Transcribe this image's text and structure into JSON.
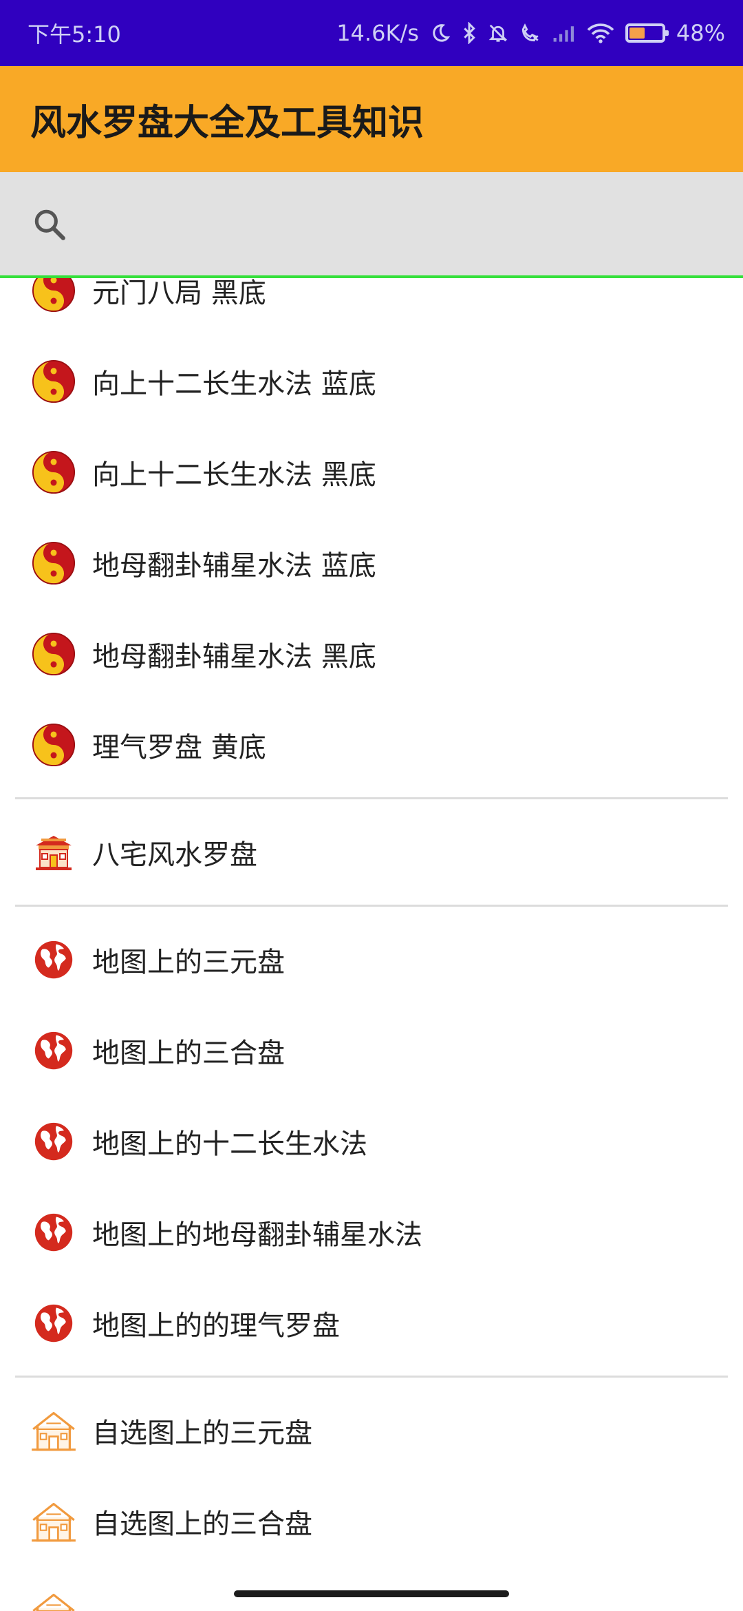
{
  "status_bar": {
    "time": "下午5:10",
    "network_speed": "14.6K/s",
    "battery_percent": "48%",
    "battery_level": 0.48,
    "icons": [
      "moon-icon",
      "bluetooth-icon",
      "mute-bell-icon",
      "call-icon",
      "signal-icon",
      "wifi-icon",
      "battery-icon"
    ]
  },
  "app_bar": {
    "title": "风水罗盘大全及工具知识"
  },
  "search": {
    "placeholder": "",
    "value": "",
    "icon": "search-icon"
  },
  "list": {
    "group_compass": [
      {
        "label": "元门八局 黑底",
        "icon": "yin-yang-icon"
      },
      {
        "label": "向上十二长生水法 蓝底",
        "icon": "yin-yang-icon"
      },
      {
        "label": "向上十二长生水法 黑底",
        "icon": "yin-yang-icon"
      },
      {
        "label": "地母翻卦辅星水法 蓝底",
        "icon": "yin-yang-icon"
      },
      {
        "label": "地母翻卦辅星水法 黑底",
        "icon": "yin-yang-icon"
      },
      {
        "label": "理气罗盘 黄底",
        "icon": "yin-yang-icon"
      }
    ],
    "group_house": [
      {
        "label": "八宅风水罗盘",
        "icon": "temple-icon"
      }
    ],
    "group_map": [
      {
        "label": "地图上的三元盘",
        "icon": "globe-icon"
      },
      {
        "label": "地图上的三合盘",
        "icon": "globe-icon"
      },
      {
        "label": "地图上的十二长生水法",
        "icon": "globe-icon"
      },
      {
        "label": "地图上的地母翻卦辅星水法",
        "icon": "globe-icon"
      },
      {
        "label": "地图上的的理气罗盘",
        "icon": "globe-icon"
      }
    ],
    "group_custom": [
      {
        "label": "自选图上的三元盘",
        "icon": "house-icon"
      },
      {
        "label": "自选图上的三合盘",
        "icon": "house-icon"
      }
    ]
  },
  "colors": {
    "status_bar": "#3000bf",
    "app_bar": "#f9a926",
    "search_bar": "#e1e1e1",
    "focus_line": "#35e03b",
    "yin_yang_red": "#c4161c",
    "yin_yang_yellow": "#f7c21b",
    "globe_red": "#d42a1e",
    "house_orange": "#f19a3e"
  }
}
